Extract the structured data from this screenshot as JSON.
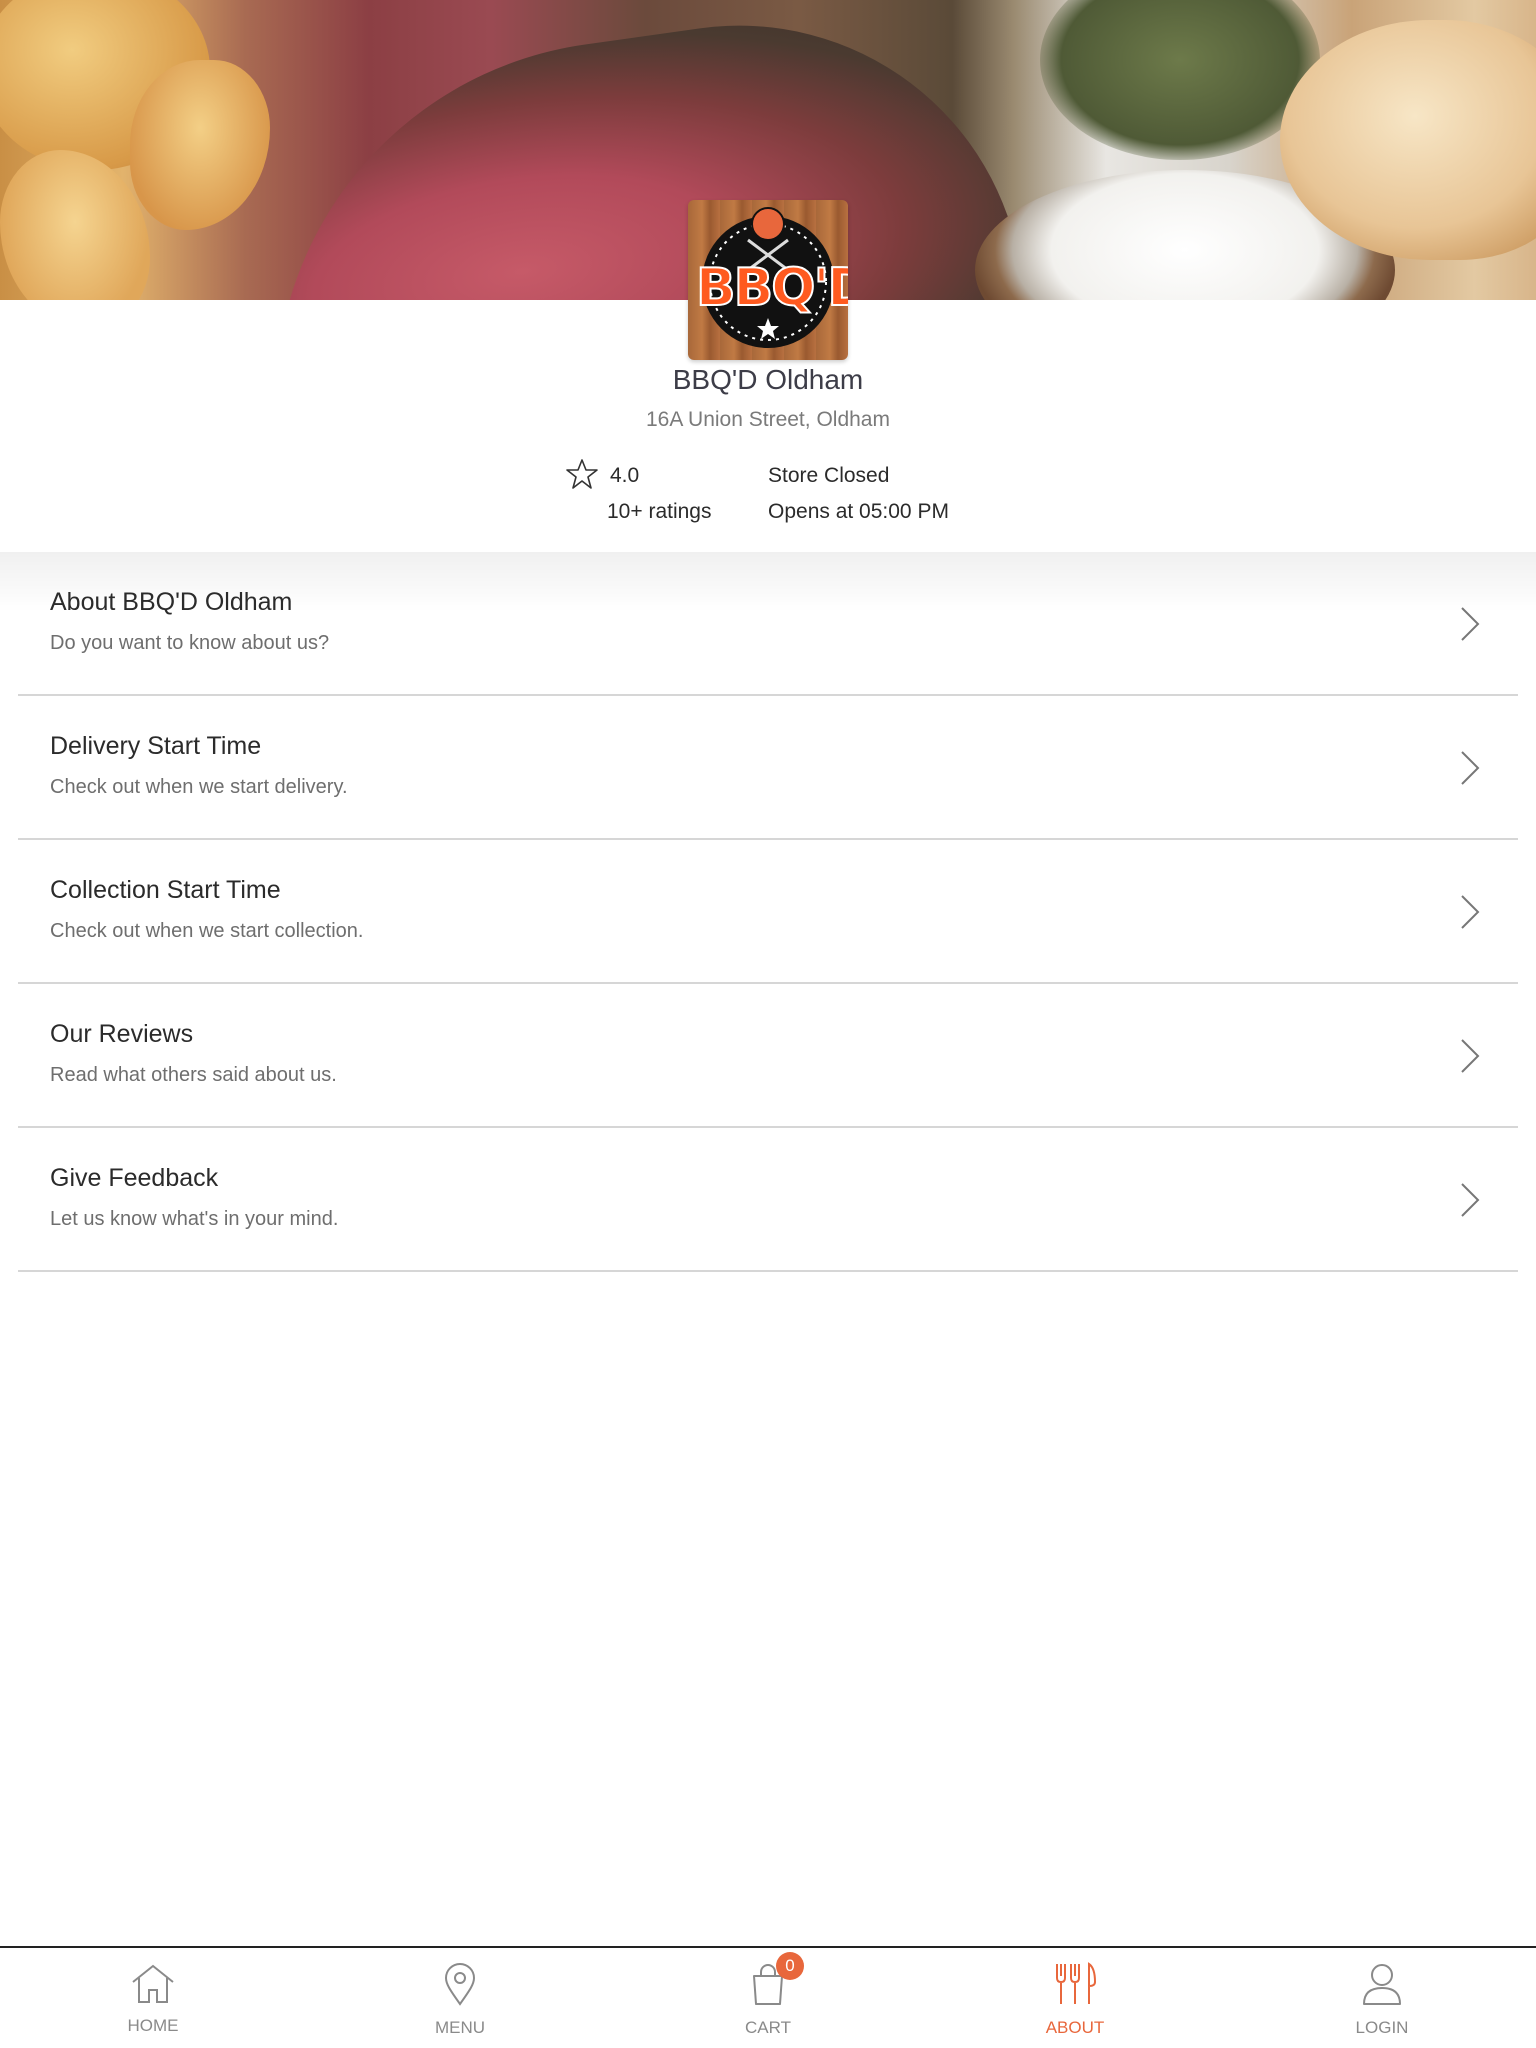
{
  "store": {
    "name": "BBQ'D Oldham",
    "address": "16A Union Street, Oldham",
    "rating": "4.0",
    "ratings_count": "10+ ratings",
    "status": "Store Closed",
    "opens_at": "Opens at 05:00 PM",
    "logo_text": "BBQ'D"
  },
  "menu": {
    "items": [
      {
        "title": "About BBQ'D Oldham",
        "subtitle": "Do you want to know about us?"
      },
      {
        "title": "Delivery Start Time",
        "subtitle": "Check out when we start delivery."
      },
      {
        "title": "Collection Start Time",
        "subtitle": "Check out when we start collection."
      },
      {
        "title": "Our Reviews",
        "subtitle": "Read what others said about us."
      },
      {
        "title": "Give Feedback",
        "subtitle": "Let us know what's in your mind."
      }
    ]
  },
  "nav": {
    "items": [
      {
        "label": "HOME",
        "icon": "home-icon"
      },
      {
        "label": "MENU",
        "icon": "location-pin-icon"
      },
      {
        "label": "CART",
        "icon": "shopping-bag-icon"
      },
      {
        "label": "ABOUT",
        "icon": "fork-knife-icon",
        "active": true
      },
      {
        "label": "LOGIN",
        "icon": "user-icon"
      }
    ],
    "cart_count": "0"
  },
  "colors": {
    "accent": "#e8673c",
    "inactive": "#8a8a8a",
    "divider": "#d6d6d6"
  }
}
